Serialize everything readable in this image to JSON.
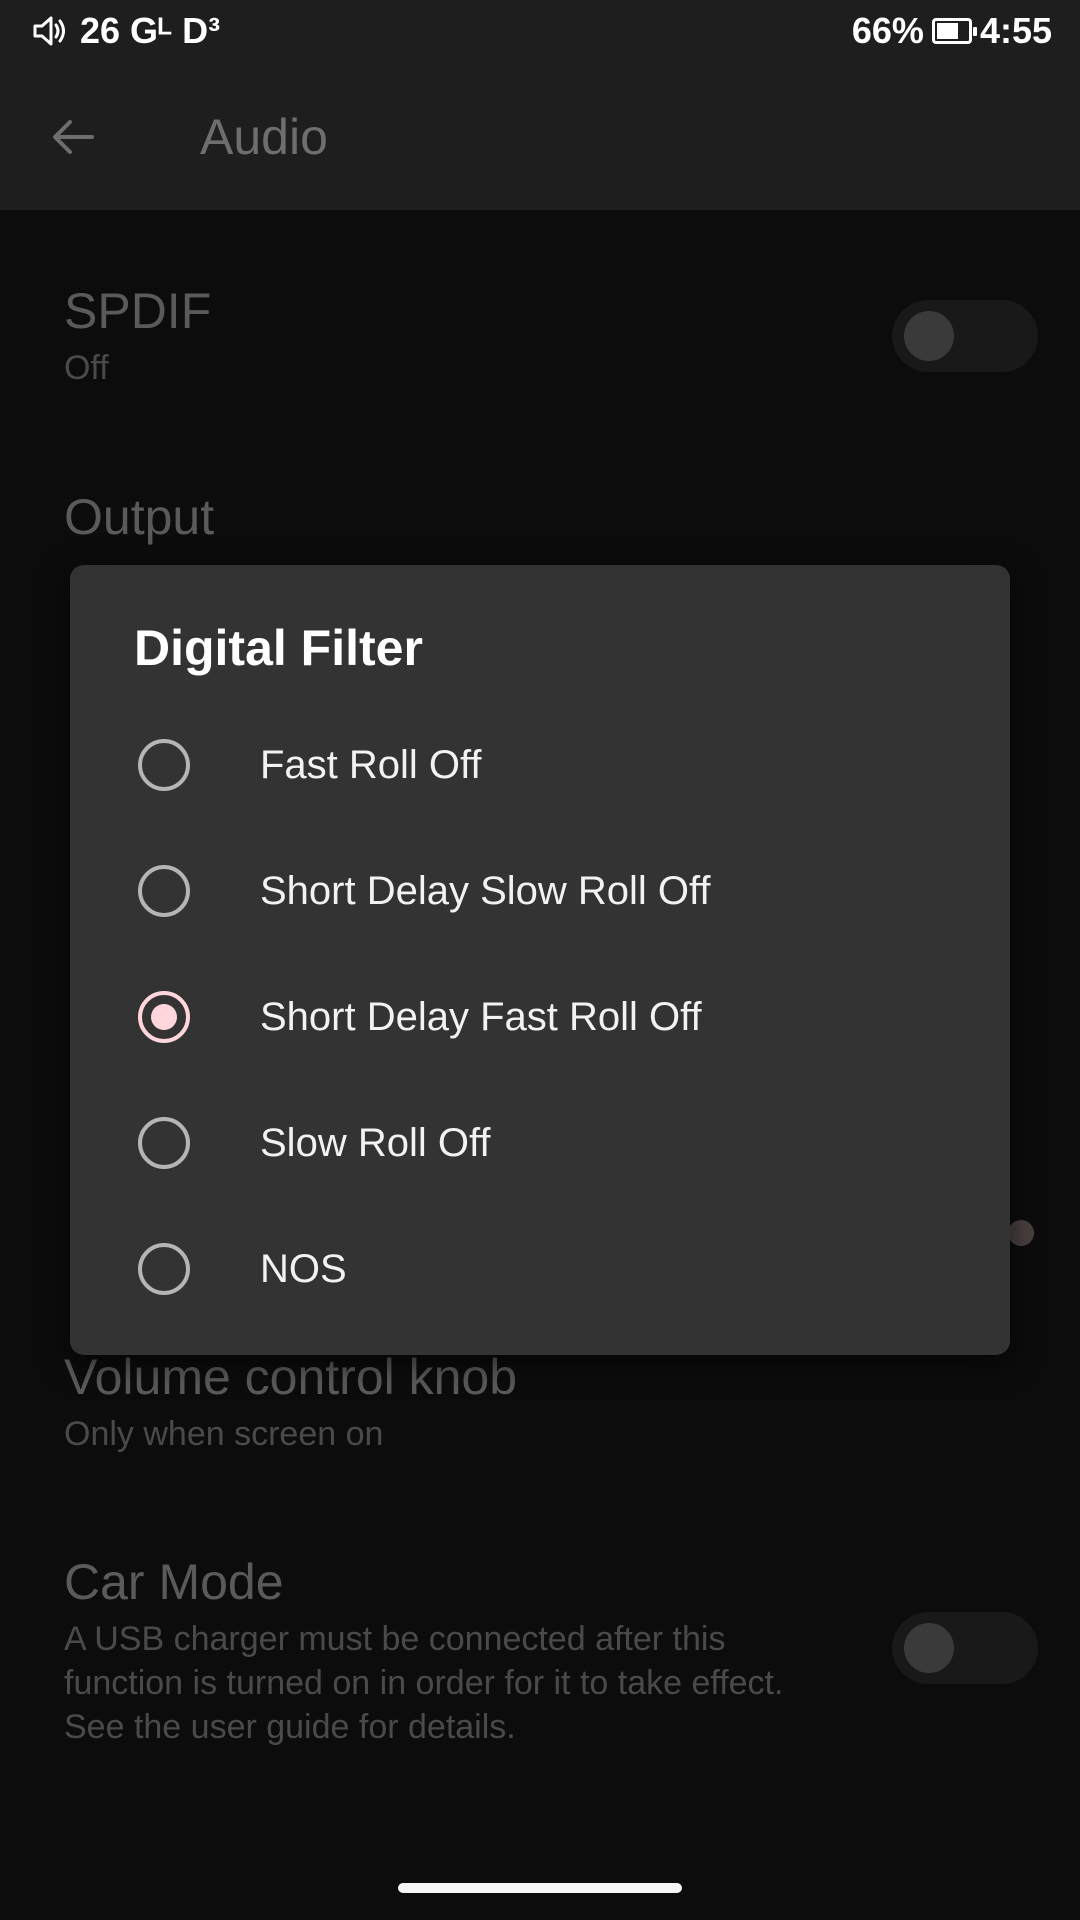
{
  "status_bar": {
    "left_text": "26  Gᴸ D³",
    "battery": "66%",
    "time": "4:55",
    "battery_level": 0.66
  },
  "app_bar": {
    "title": "Audio",
    "back_icon": "arrow-back-icon"
  },
  "settings": {
    "spdif": {
      "title": "SPDIF",
      "summary": "Off",
      "enabled": false
    },
    "output": {
      "title": "Output"
    },
    "volume_knob": {
      "title": "Volume control knob",
      "summary": "Only when screen on"
    },
    "car_mode": {
      "title": "Car Mode",
      "summary": "A USB charger must be connected after this function is turned on in order for it to take effect. See the user guide for details.",
      "enabled": false
    }
  },
  "dialog": {
    "title": "Digital Filter",
    "options": [
      {
        "label": "Fast Roll Off",
        "selected": false
      },
      {
        "label": "Short Delay Slow Roll Off",
        "selected": false
      },
      {
        "label": "Short Delay Fast Roll Off",
        "selected": true
      },
      {
        "label": "Slow Roll Off",
        "selected": false
      },
      {
        "label": "NOS",
        "selected": false
      }
    ]
  },
  "colors": {
    "dialog_bg": "#333333",
    "accent_radio": "#ffd6dc",
    "background": "#0c0c0c"
  }
}
